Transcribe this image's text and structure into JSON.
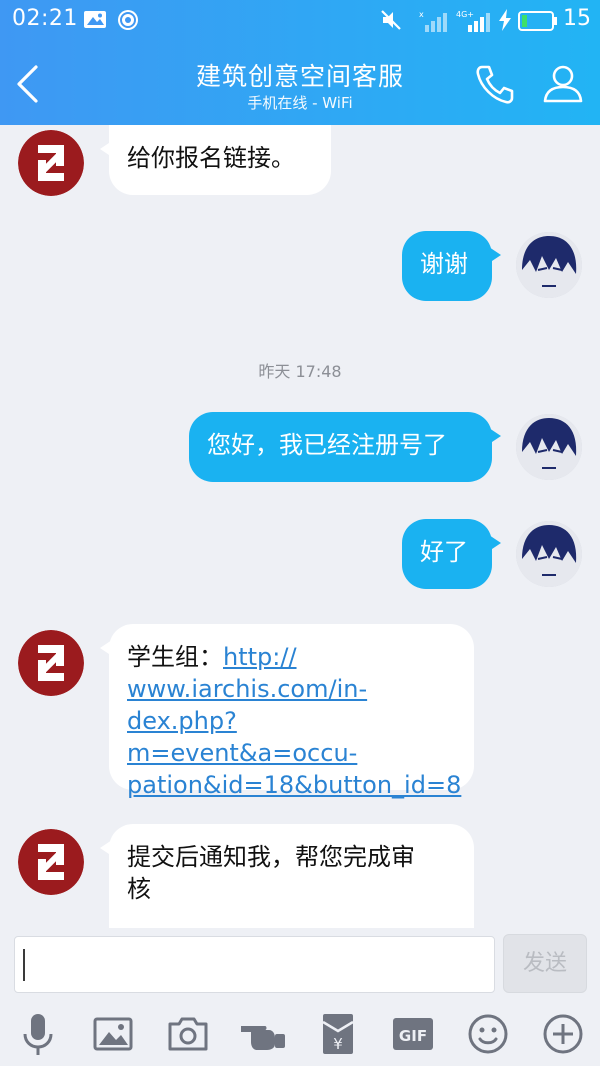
{
  "status_bar": {
    "time": "02:21",
    "battery_level": "15"
  },
  "header": {
    "title": "建筑创意空间客服",
    "subtitle": "手机在线 - WiFi"
  },
  "messages": [
    {
      "side": "in",
      "text": "给你报名链接。"
    },
    {
      "side": "out",
      "text": "谢谢"
    },
    {
      "timestamp": "昨天 17:48"
    },
    {
      "side": "out",
      "text": "您好，我已经注册号了"
    },
    {
      "side": "out",
      "text": "好了"
    },
    {
      "side": "in",
      "prefix": "学生组：",
      "link_line1": "http://",
      "link_line2": "www.iarchis.com/in-",
      "link_line3": "dex.php?m=event&a=occu-",
      "link_line4": "pation&id=18&button_id=8"
    },
    {
      "side": "in",
      "line1": "提交后通知我，帮您完成审",
      "line2": "核"
    }
  ],
  "composer": {
    "send_label": "发送",
    "input_value": ""
  },
  "toolbar": {
    "icons": [
      "microphone-icon",
      "image-icon",
      "camera-icon",
      "pointing-hand-icon",
      "red-packet-icon",
      "gif-icon",
      "emoji-icon",
      "plus-icon"
    ],
    "gif_label": "GIF"
  },
  "colors": {
    "header_start": "#3f98f3",
    "header_end": "#22b4f4",
    "bubble_out": "#1ab2f1",
    "link": "#2a83d3",
    "logo_red": "#9b1b1e"
  }
}
